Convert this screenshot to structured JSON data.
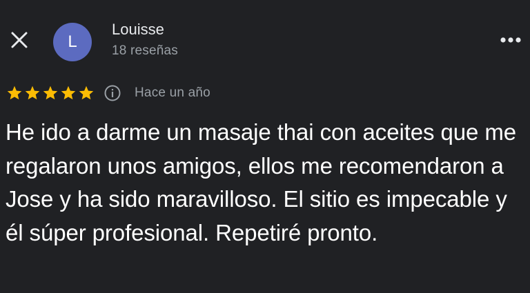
{
  "header": {
    "close_icon": "close-icon",
    "avatar_initial": "L",
    "avatar_color": "#5c6bc0",
    "author_name": "Louisse",
    "review_count": "18 reseñas",
    "more_icon": "more-horizontal-icon"
  },
  "rating": {
    "stars": 5,
    "max_stars": 5,
    "star_color": "#fbbc04",
    "info_icon": "info-icon",
    "date": "Hace un año"
  },
  "review": {
    "text": "He ido a darme un masaje thai con aceites que me regalaron unos amigos, ellos me recomendaron a Jose y ha sido maravilloso. El sitio es impecable y él súper profesional. Repetiré pronto."
  },
  "theme": {
    "background": "#202124",
    "text_primary": "#ffffff",
    "text_secondary": "#9aa0a6"
  }
}
